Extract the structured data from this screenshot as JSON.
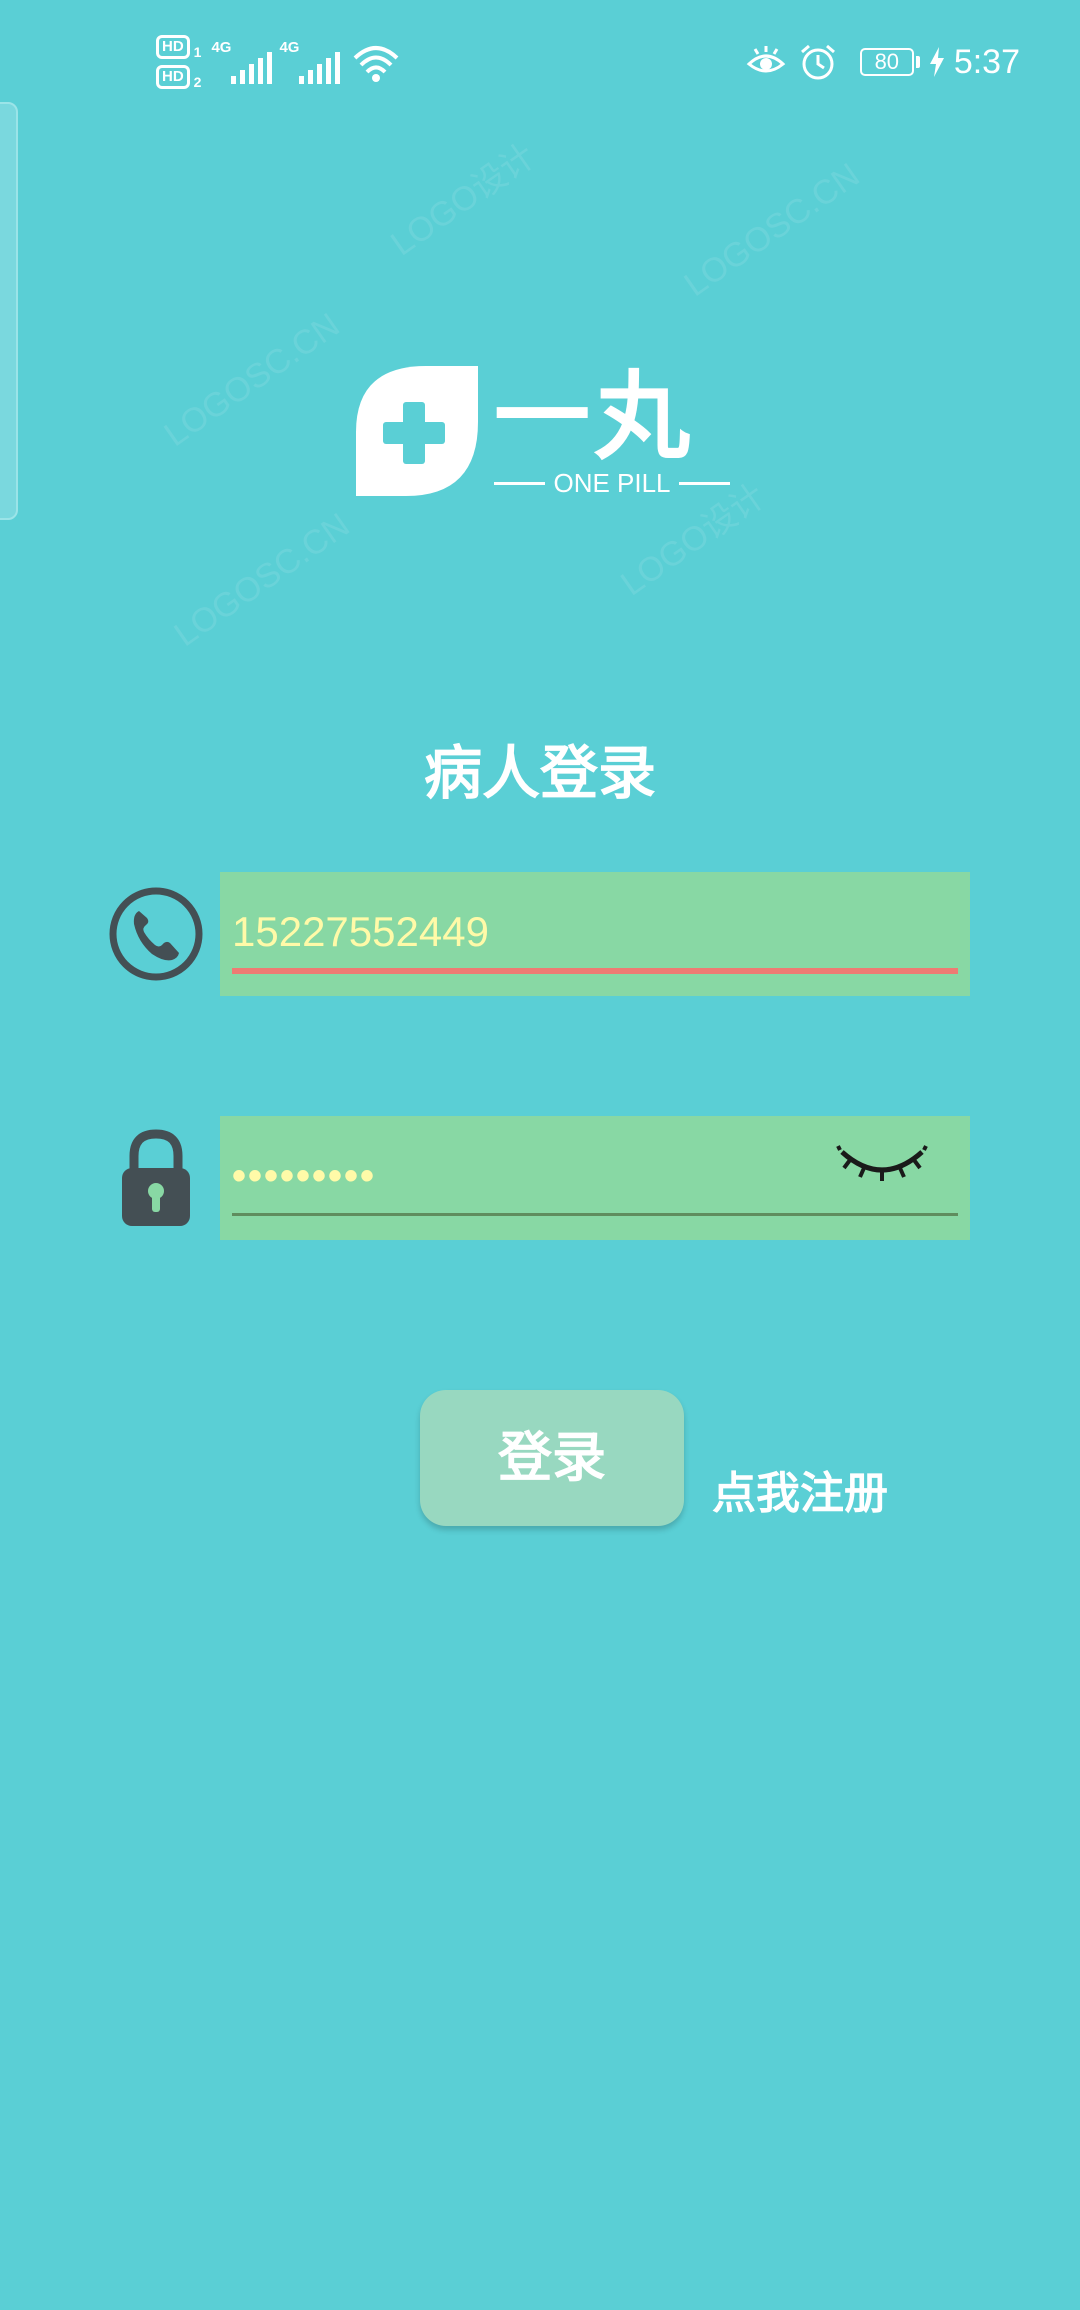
{
  "status_bar": {
    "sim1_label": "HD",
    "sim1_num": "1",
    "sim2_label": "HD",
    "sim2_num": "2",
    "network1": "4G",
    "network2": "4G",
    "battery_level": "80",
    "time": "5:37",
    "icons": [
      "signal-icon",
      "wifi-icon",
      "eye-comfort-icon",
      "alarm-icon",
      "battery-icon",
      "charging-bolt-icon"
    ]
  },
  "logo": {
    "name": "一丸",
    "subtitle": "ONE PILL"
  },
  "watermark": {
    "text": "LOGOSC.CN",
    "text_cn": "LOGO设计"
  },
  "login": {
    "title": "病人登录",
    "phone": {
      "value": "15227552449",
      "icon": "phone-icon"
    },
    "password": {
      "value": "•••••••••",
      "icon": "lock-icon",
      "toggle_icon": "eye-closed-icon"
    },
    "submit_label": "登录",
    "register_label": "点我注册"
  },
  "colors": {
    "background": "#5acfd5",
    "field_background": "#88d8a4",
    "input_text": "#fffaa8",
    "active_underline": "#ee7b73",
    "button_background": "#98d8c0"
  }
}
